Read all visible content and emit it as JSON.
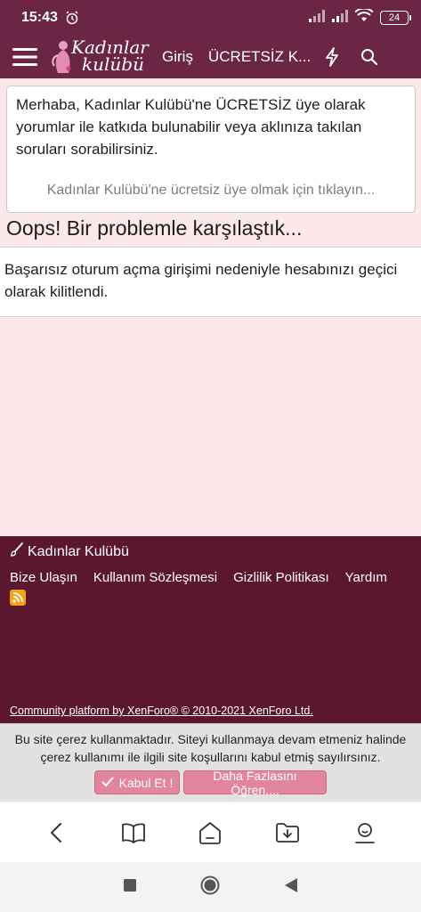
{
  "status_bar": {
    "time": "15:43",
    "battery": "24",
    "icons": [
      "alarm-icon",
      "signal-icon",
      "signal-icon",
      "wifi-icon",
      "battery-icon"
    ]
  },
  "header": {
    "logo_line1": "Kadınlar",
    "logo_line2": "kulübü",
    "login": "Giriş",
    "register": "ÜCRETSİZ K...",
    "icons": [
      "menu-icon",
      "lightning-icon",
      "search-icon"
    ],
    "background": "#6b2545"
  },
  "notice": {
    "text": "Merhaba, Kadınlar Kulübü'ne ÜCRETSİZ üye olarak yorumlar ile katkıda bulunabilir veya aklınıza takılan soruları sorabilirsiniz.",
    "link": "Kadınlar Kulübü'ne ücretsiz üye olmak için tıklayın..."
  },
  "error": {
    "title": "Oops! Bir problemle karşılaştık...",
    "message": "Başarısız oturum açma girişimi nedeniyle hesabınızı geçici olarak kilitlendi."
  },
  "footer": {
    "brand": "Kadınlar Kulübü",
    "links": [
      "Bize Ulaşın",
      "Kullanım Sözleşmesi",
      "Gizlilik Politikası",
      "Yardım"
    ],
    "copyright": "Community platform by XenForo® © 2010-2021 XenForo Ltd.",
    "background": "#5b1730"
  },
  "cookie": {
    "text": "Bu site çerez kullanmaktadır. Siteyi kullanmaya devam etmeniz halinde çerez kullanımı ile ilgili site koşullarını kabul etmiş sayılırsınız.",
    "accept": "Kabul Et !",
    "learn_more": "Daha Fazlasını Öğren....",
    "button_color": "#e1869d"
  },
  "browser_nav": {
    "icons": [
      "back-icon",
      "book-icon",
      "home-icon",
      "download-folder-icon",
      "profile-icon"
    ]
  },
  "system_nav": {
    "icons": [
      "recent-apps-icon",
      "home-circle-icon",
      "back-triangle-icon"
    ]
  }
}
